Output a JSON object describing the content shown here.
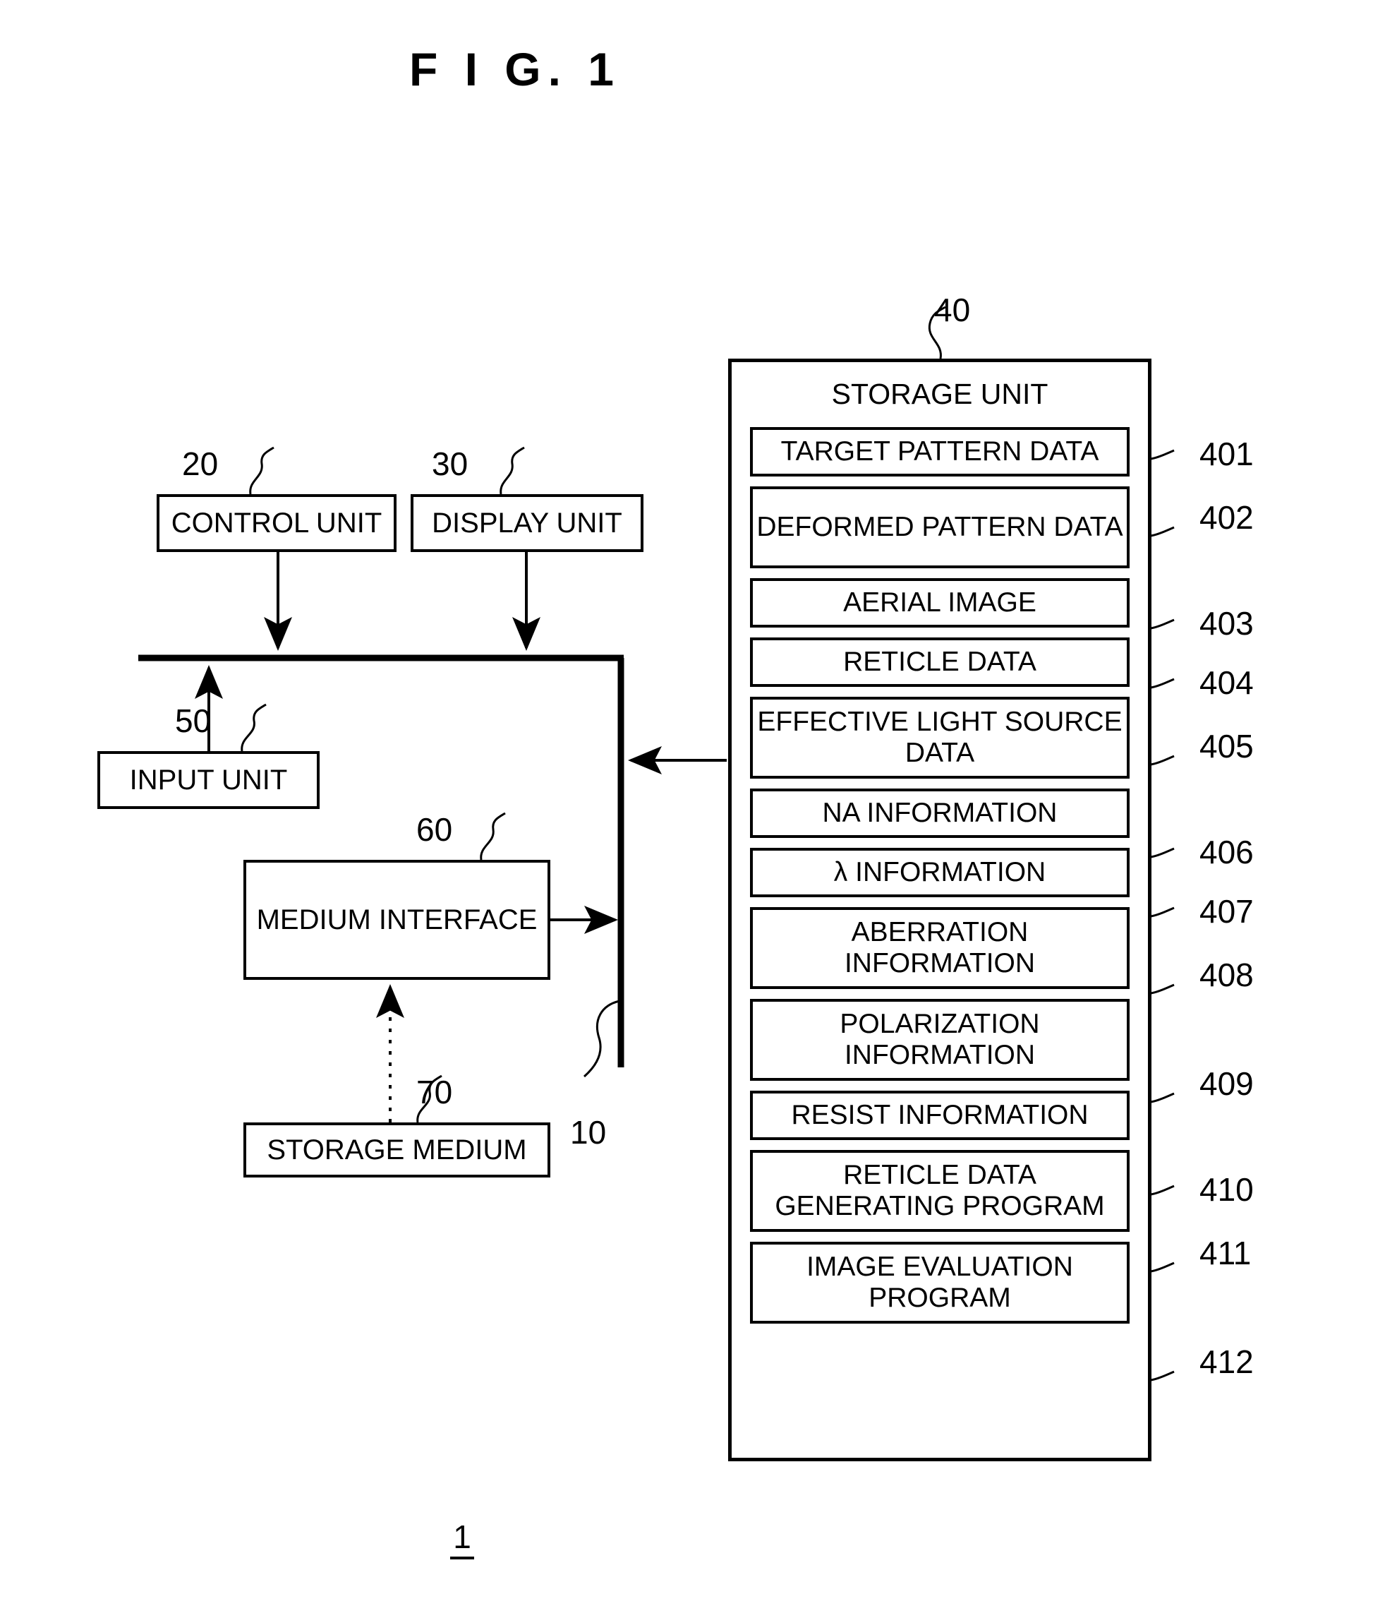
{
  "figure": {
    "title": "F I G.  1",
    "bottom_numeral": "1"
  },
  "blocks": {
    "control_unit": {
      "label": "CONTROL UNIT",
      "ref": "20"
    },
    "display_unit": {
      "label": "DISPLAY UNIT",
      "ref": "30"
    },
    "input_unit": {
      "label": "INPUT UNIT",
      "ref": "50"
    },
    "medium_interface": {
      "label": "MEDIUM INTERFACE",
      "ref": "60"
    },
    "storage_medium": {
      "label": "STORAGE MEDIUM",
      "ref": "70"
    },
    "bus": {
      "ref": "10"
    },
    "storage_unit": {
      "label": "STORAGE UNIT",
      "ref": "40"
    }
  },
  "storage_unit_items": [
    {
      "label": "TARGET PATTERN DATA",
      "ref": "401",
      "lines": 1
    },
    {
      "label": "DEFORMED PATTERN DATA",
      "ref": "402",
      "lines": 2
    },
    {
      "label": "AERIAL IMAGE",
      "ref": "403",
      "lines": 1
    },
    {
      "label": "RETICLE DATA",
      "ref": "404",
      "lines": 1
    },
    {
      "label": "EFFECTIVE LIGHT SOURCE DATA",
      "ref": "405",
      "lines": 2
    },
    {
      "label": "NA INFORMATION",
      "ref": "406",
      "lines": 1
    },
    {
      "label": "λ INFORMATION",
      "ref": "407",
      "lines": 1
    },
    {
      "label": "ABERRATION INFORMATION",
      "ref": "408",
      "lines": 2
    },
    {
      "label": "POLARIZATION INFORMATION",
      "ref": "409",
      "lines": 2
    },
    {
      "label": "RESIST INFORMATION",
      "ref": "410",
      "lines": 1
    },
    {
      "label": "RETICLE DATA GENERATING PROGRAM",
      "ref": "411",
      "lines": 2
    },
    {
      "label": "IMAGE EVALUATION PROGRAM",
      "ref": "412",
      "lines": 2
    }
  ],
  "colors": {
    "ink": "#000000",
    "paper": "#ffffff"
  }
}
